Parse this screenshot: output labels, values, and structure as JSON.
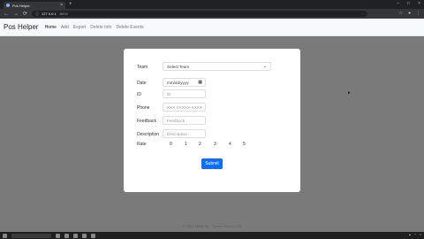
{
  "browser": {
    "tab_title": "Pos Helper",
    "new_tab": "+",
    "url_host": "127.0.0.1",
    "url_path": ":5000"
  },
  "navbar": {
    "brand": "Pos Helper",
    "links": [
      {
        "label": "Home"
      },
      {
        "label": "Add"
      },
      {
        "label": "Export"
      },
      {
        "label": "Delete Info"
      },
      {
        "label": "Delete Events"
      }
    ]
  },
  "form": {
    "team": {
      "label": "Team",
      "value": "Select Team"
    },
    "date": {
      "label": "Date",
      "value": "mm/dd/yyyy"
    },
    "id": {
      "label": "ID",
      "placeholder": "ID"
    },
    "phone": {
      "label": "Phone",
      "placeholder": "XXX-XXXXX-XXXX"
    },
    "feedback": {
      "label": "Feedback",
      "placeholder": "Feedback"
    },
    "description": {
      "label": "Description",
      "placeholder": "Description"
    },
    "rate": {
      "label": "Rate",
      "options": [
        "0",
        "1",
        "2",
        "3",
        "4",
        "5"
      ]
    },
    "submit_label": "Submit"
  },
  "footer": {
    "text": "© 2021 Made By - Tomer Peretz, LTD"
  },
  "colors": {
    "primary": "#0d6efd",
    "backdrop": "#7a7a7a"
  }
}
